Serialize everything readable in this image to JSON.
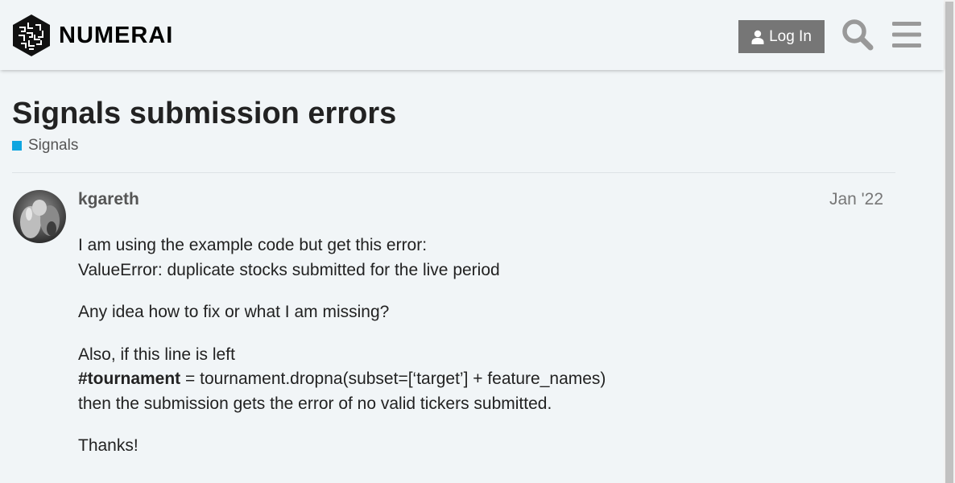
{
  "header": {
    "logo_text": "NUMERAI",
    "login_label": "Log In",
    "search_icon": "search-icon",
    "menu_icon": "hamburger-menu-icon"
  },
  "topic": {
    "title": "Signals submission errors",
    "category": "Signals",
    "category_color": "#0fa6e0"
  },
  "post": {
    "username": "kgareth",
    "date": "Jan '22",
    "lines": {
      "p1_l1": "I am using the example code but get this error:",
      "p1_l2": "ValueError: duplicate stocks submitted for the live period",
      "p2": "Any idea how to fix or what I am missing?",
      "p3_l1": "Also, if this line is left",
      "p3_l2_bold": "#tournament",
      "p3_l2_rest": " = tournament.dropna(subset=[‘target’] + feature_names)",
      "p3_l3": "then the submission gets the error of no valid tickers submitted.",
      "p4": "Thanks!"
    }
  }
}
